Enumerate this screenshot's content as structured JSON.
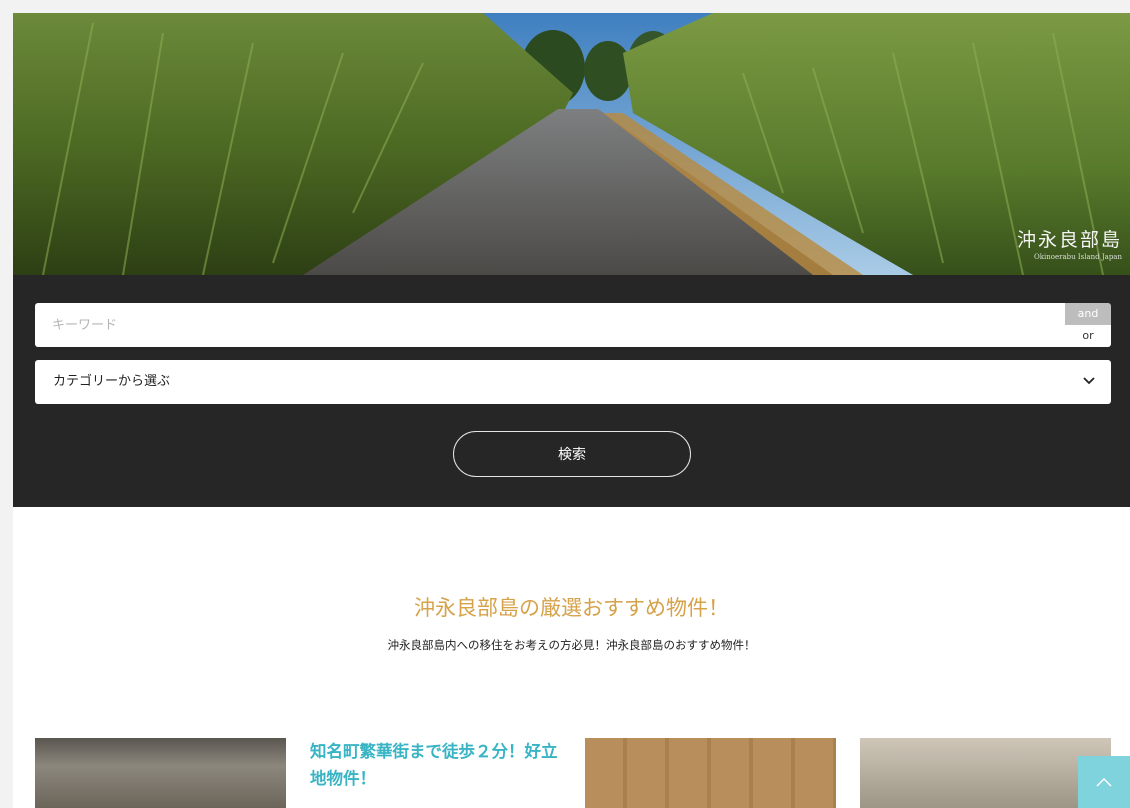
{
  "hero": {
    "logo_jp": "沖永良部島",
    "logo_en": "Okinoerabu Island Japan"
  },
  "search": {
    "keyword_placeholder": "キーワード",
    "keyword_value": "",
    "mode_and": "and",
    "mode_or": "or",
    "category_selected": "カテゴリーから選ぶ",
    "submit_label": "検索"
  },
  "recommend": {
    "title": "沖永良部島の厳選おすすめ物件！",
    "subtitle": "沖永良部島内への移住をお考えの方必見！沖永良部島のおすすめ物件！",
    "cards": [
      {
        "title": "知名町繁華街まで徒歩２分！好立地物件！"
      }
    ]
  },
  "colors": {
    "accent_orange": "#d6a24a",
    "accent_teal": "#38b4c4",
    "panel": "#262626",
    "to_top": "#7fd3dd"
  },
  "icons": {
    "select": "chevron-down-icon",
    "to_top": "chevron-up-icon"
  }
}
